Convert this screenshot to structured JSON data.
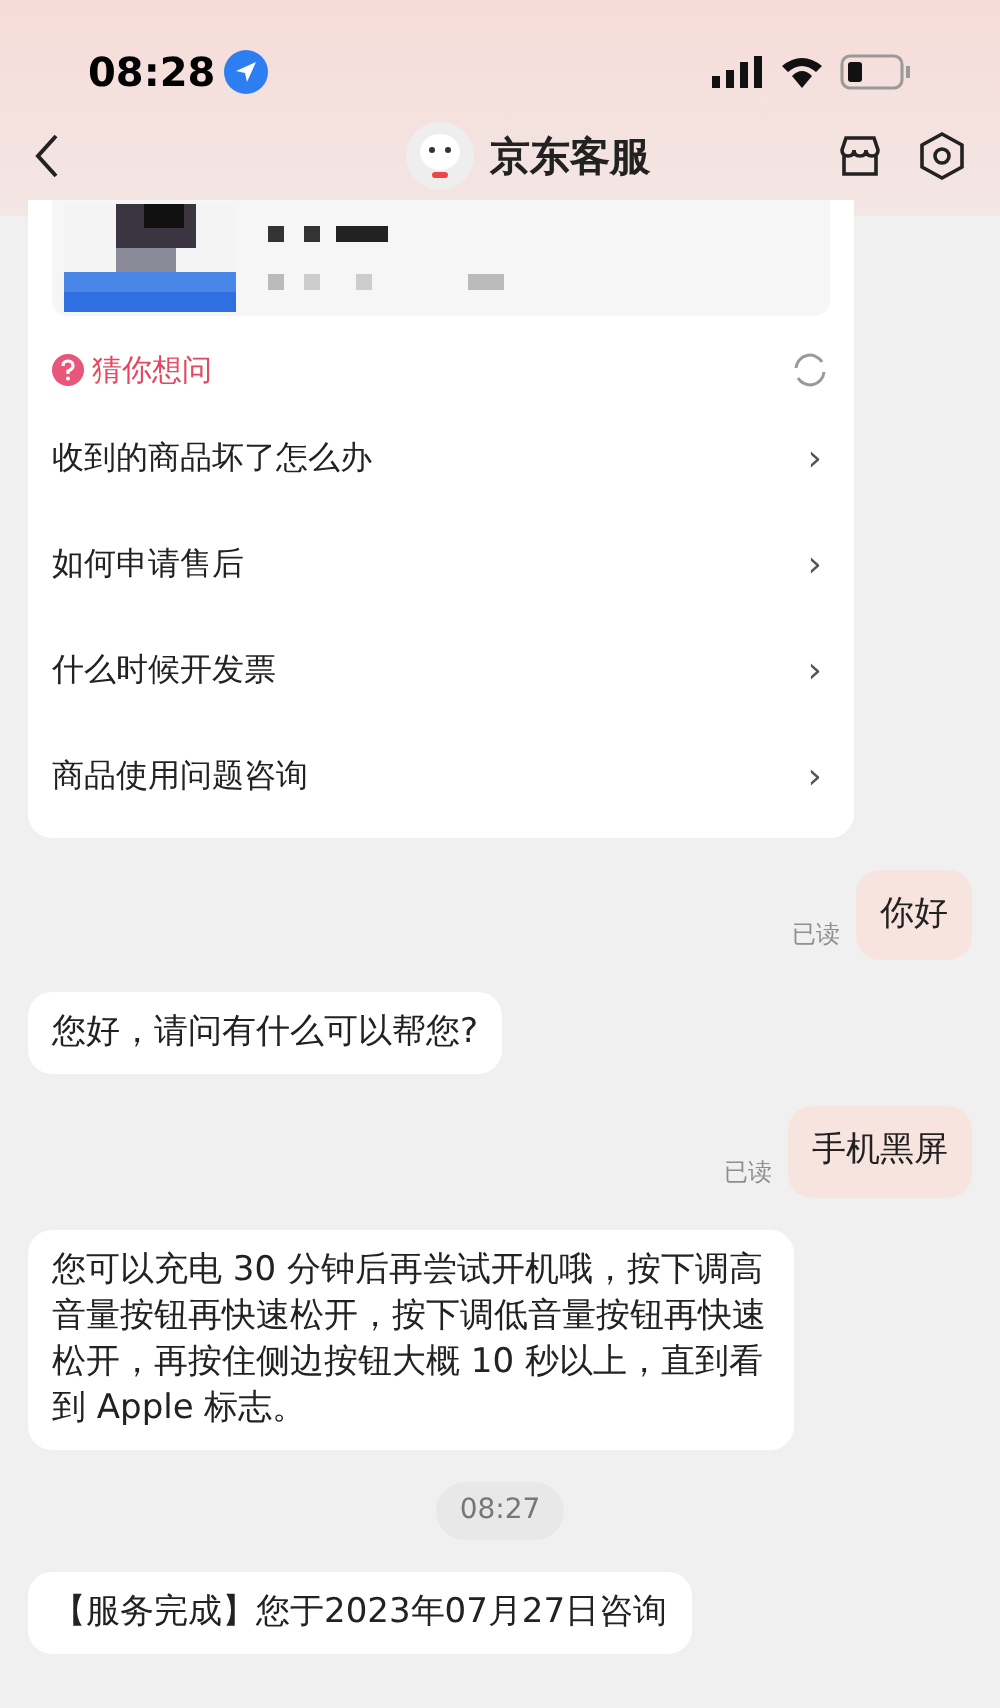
{
  "status_bar": {
    "time": "08:28"
  },
  "header": {
    "title": "京东客服"
  },
  "suggestions": {
    "title": "猜你想问",
    "items": [
      {
        "label": "收到的商品坏了怎么办",
        "arrow": "›"
      },
      {
        "label": "如何申请售后",
        "arrow": "›"
      },
      {
        "label": "什么时候开发票",
        "arrow": "›"
      },
      {
        "label": "商品使用问题咨询",
        "arrow": "›"
      }
    ]
  },
  "messages": [
    {
      "kind": "outgoing",
      "text": "你好",
      "status": "已读"
    },
    {
      "kind": "incoming",
      "text": "您好，请问有什么可以帮您?"
    },
    {
      "kind": "outgoing",
      "text": "手机黑屏",
      "status": "已读"
    },
    {
      "kind": "incoming",
      "text": "您可以充电 30 分钟后再尝试开机哦，按下调高音量按钮再快速松开，按下调低音量按钮再快速松开，再按住侧边按钮大概 10 秒以上，直到看到 Apple 标志。"
    },
    {
      "kind": "time",
      "text": "08:27"
    },
    {
      "kind": "incoming",
      "text": "【服务完成】您于2023年07月27日咨询"
    }
  ]
}
